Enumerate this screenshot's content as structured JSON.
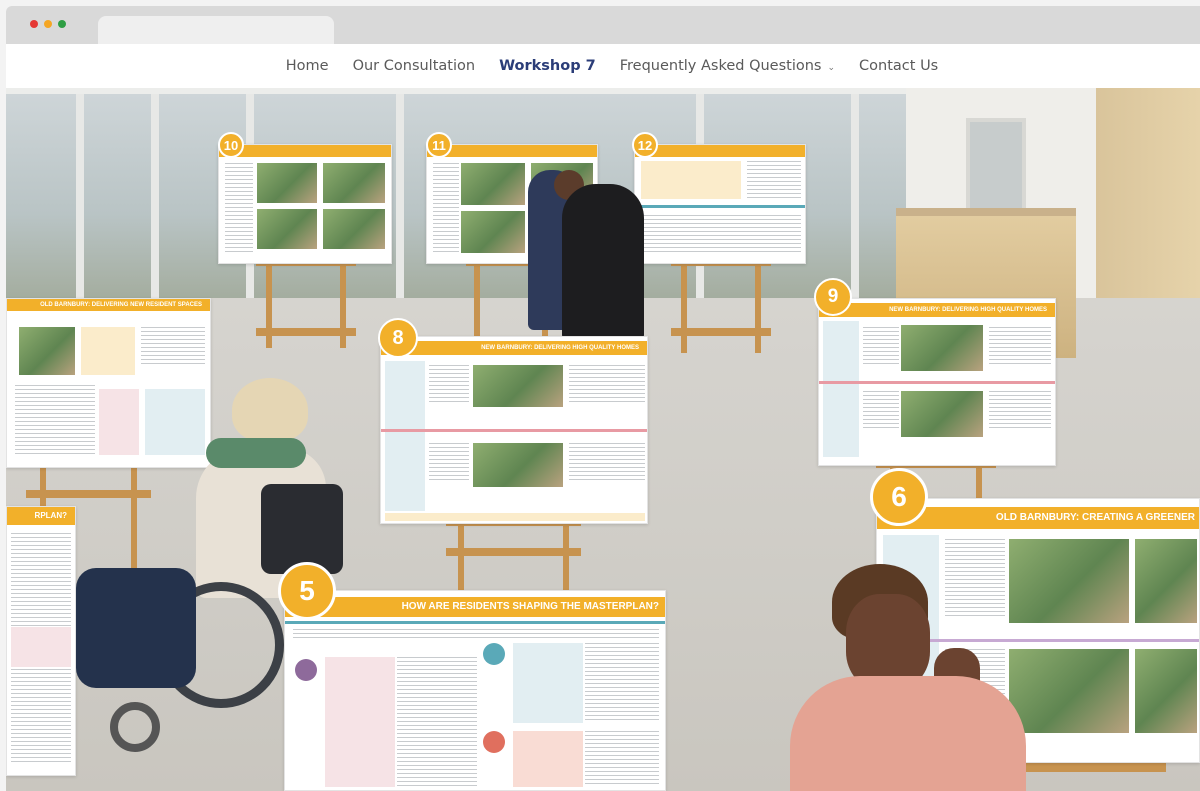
{
  "browser": {
    "dots": [
      "#e53935",
      "#f5a623",
      "#2e9e44"
    ]
  },
  "nav": {
    "items": [
      {
        "label": "Home"
      },
      {
        "label": "Our Consultation"
      },
      {
        "label": "Workshop 7"
      },
      {
        "label": "Frequently Asked Questions"
      },
      {
        "label": "Contact Us"
      }
    ],
    "active_index": 2,
    "accent": "#2b3d78"
  },
  "boards": {
    "b5": {
      "number": "5",
      "title": "HOW ARE RESIDENTS SHAPING THE MASTERPLAN?"
    },
    "b6": {
      "number": "6",
      "title": "OLD BARNBURY: CREATING A GREENER"
    },
    "b8": {
      "number": "8",
      "title": "NEW BARNBURY: DELIVERING HIGH QUALITY HOMES"
    },
    "b9": {
      "number": "9",
      "title": "NEW BARNBURY: DELIVERING HIGH QUALITY HOMES"
    },
    "b10": {
      "number": "10",
      "title": ""
    },
    "b11": {
      "number": "11",
      "title": ""
    },
    "b12": {
      "number": "12",
      "title": ""
    },
    "bL1": {
      "title": "OLD BARNBURY: DELIVERING NEW RESIDENT SPACES"
    },
    "bL2": {
      "title": "RPLAN?"
    }
  },
  "colors": {
    "board_accent": "#f2b02a",
    "teal": "#5aa9b8"
  }
}
